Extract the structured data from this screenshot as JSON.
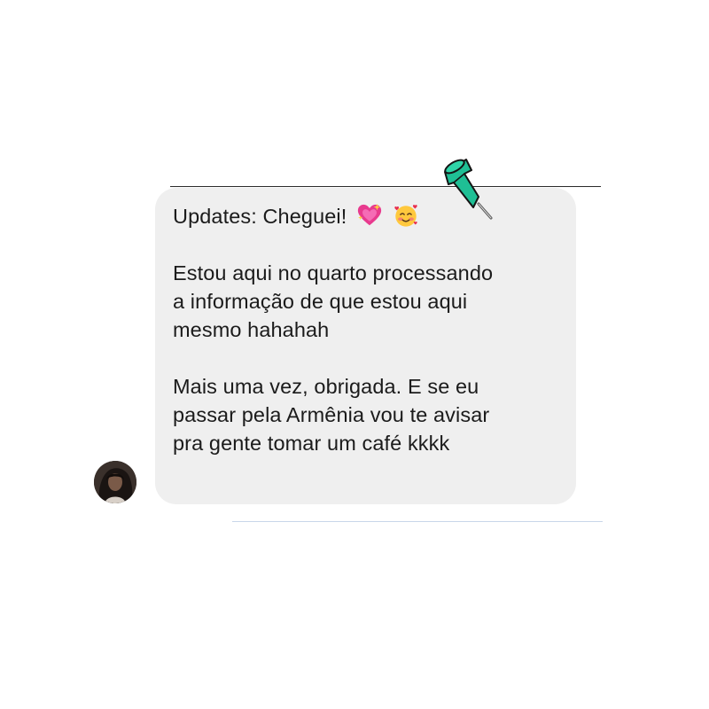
{
  "message": {
    "header": "Updates: Cheguei!",
    "paragraphs": [
      [
        "Estou aqui no quarto processando",
        "a informação de que estou aqui",
        "mesmo hahahah"
      ],
      [
        "Mais uma vez, obrigada. E se eu",
        "passar pela Armênia vou te avisar",
        "pra gente tomar um café kkkk"
      ]
    ],
    "emojis": [
      "sparkling-heart-icon",
      "smiling-face-with-hearts-icon"
    ],
    "bubble_color": "#efefef",
    "text_color": "#1b1b1b"
  },
  "pin": {
    "icon": "pushpin-icon",
    "color": "#1fbf95"
  },
  "sender": {
    "avatar_icon": "profile-photo"
  }
}
